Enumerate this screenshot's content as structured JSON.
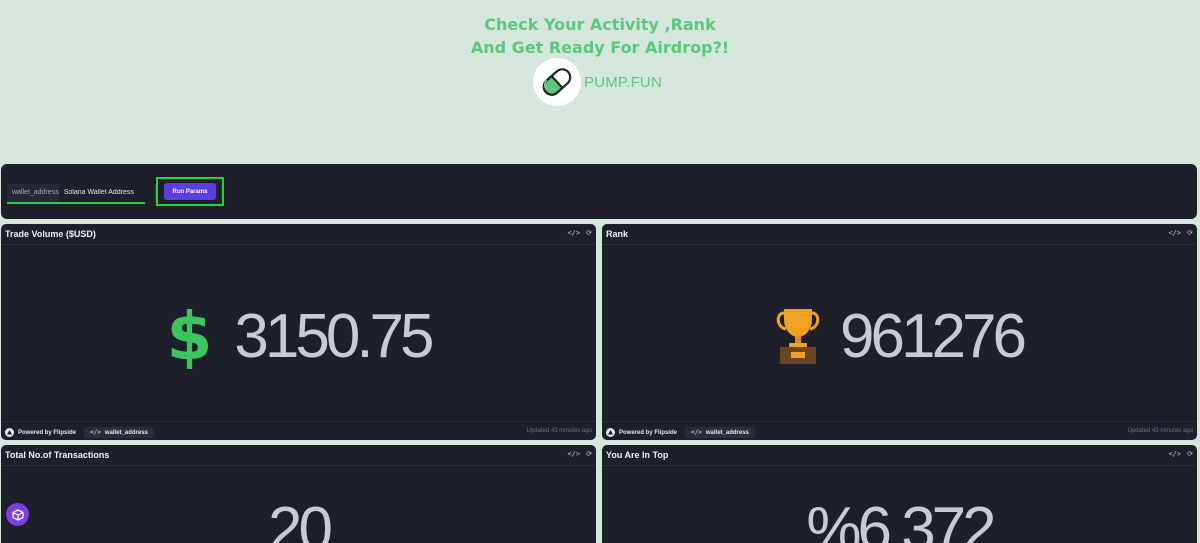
{
  "header": {
    "title_line1": "Check Your Activity ,Rank",
    "title_line2": "And Get Ready For Airdrop?!",
    "brand_name": "PUMP.FUN",
    "logo_icon": "pill-icon"
  },
  "params": {
    "field_key": "wallet_address",
    "field_value": "Solana Wallet Address",
    "run_label": "Run Params"
  },
  "cards": [
    {
      "title": "Trade Volume ($USD)",
      "value": "3150.75",
      "icon": "dollar-icon",
      "footer": {
        "powered_by": "Powered by Flipside",
        "param_chip": "wallet_address",
        "updated": "Updated 43 minutes ago"
      }
    },
    {
      "title": "Rank",
      "value": "961276",
      "icon": "trophy-icon",
      "footer": {
        "powered_by": "Powered by Flipside",
        "param_chip": "wallet_address",
        "updated": "Updated 43 minutes ago"
      }
    },
    {
      "title": "Total No.of Transactions",
      "value": "20"
    },
    {
      "title": "You Are In Top",
      "value": "%6.372"
    }
  ],
  "card_actions": {
    "embed_symbol": "</>",
    "refresh_symbol": "⟳"
  },
  "colors": {
    "background": "#d5e7dd",
    "card": "#1d1f2b",
    "accent_green": "#5dc77a",
    "highlight_green": "#22d43b",
    "button_purple": "#5a3ee0",
    "dollar_green": "#3cc45f",
    "trophy_gold": "#f2a024"
  }
}
